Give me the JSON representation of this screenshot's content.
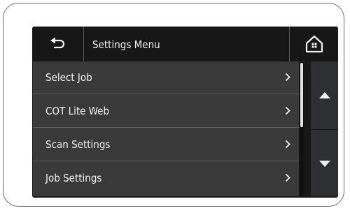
{
  "header": {
    "title": "Settings Menu",
    "back_icon": "return-arrow-icon",
    "home_icon": "home-icon"
  },
  "menu": {
    "items": [
      {
        "label": "Select Job",
        "icon": "chevron-right-icon"
      },
      {
        "label": "COT Lite Web",
        "icon": "chevron-right-icon"
      },
      {
        "label": "Scan Settings",
        "icon": "chevron-right-icon"
      },
      {
        "label": "Job Settings",
        "icon": "chevron-right-icon"
      }
    ]
  },
  "scroll": {
    "up_icon": "triangle-up-icon",
    "down_icon": "triangle-down-icon"
  },
  "colors": {
    "screen_bg": "#181818",
    "list_bg": "#3a3a3a",
    "text": "#f2f2f2",
    "scroll_panel": "#2d2f33"
  }
}
